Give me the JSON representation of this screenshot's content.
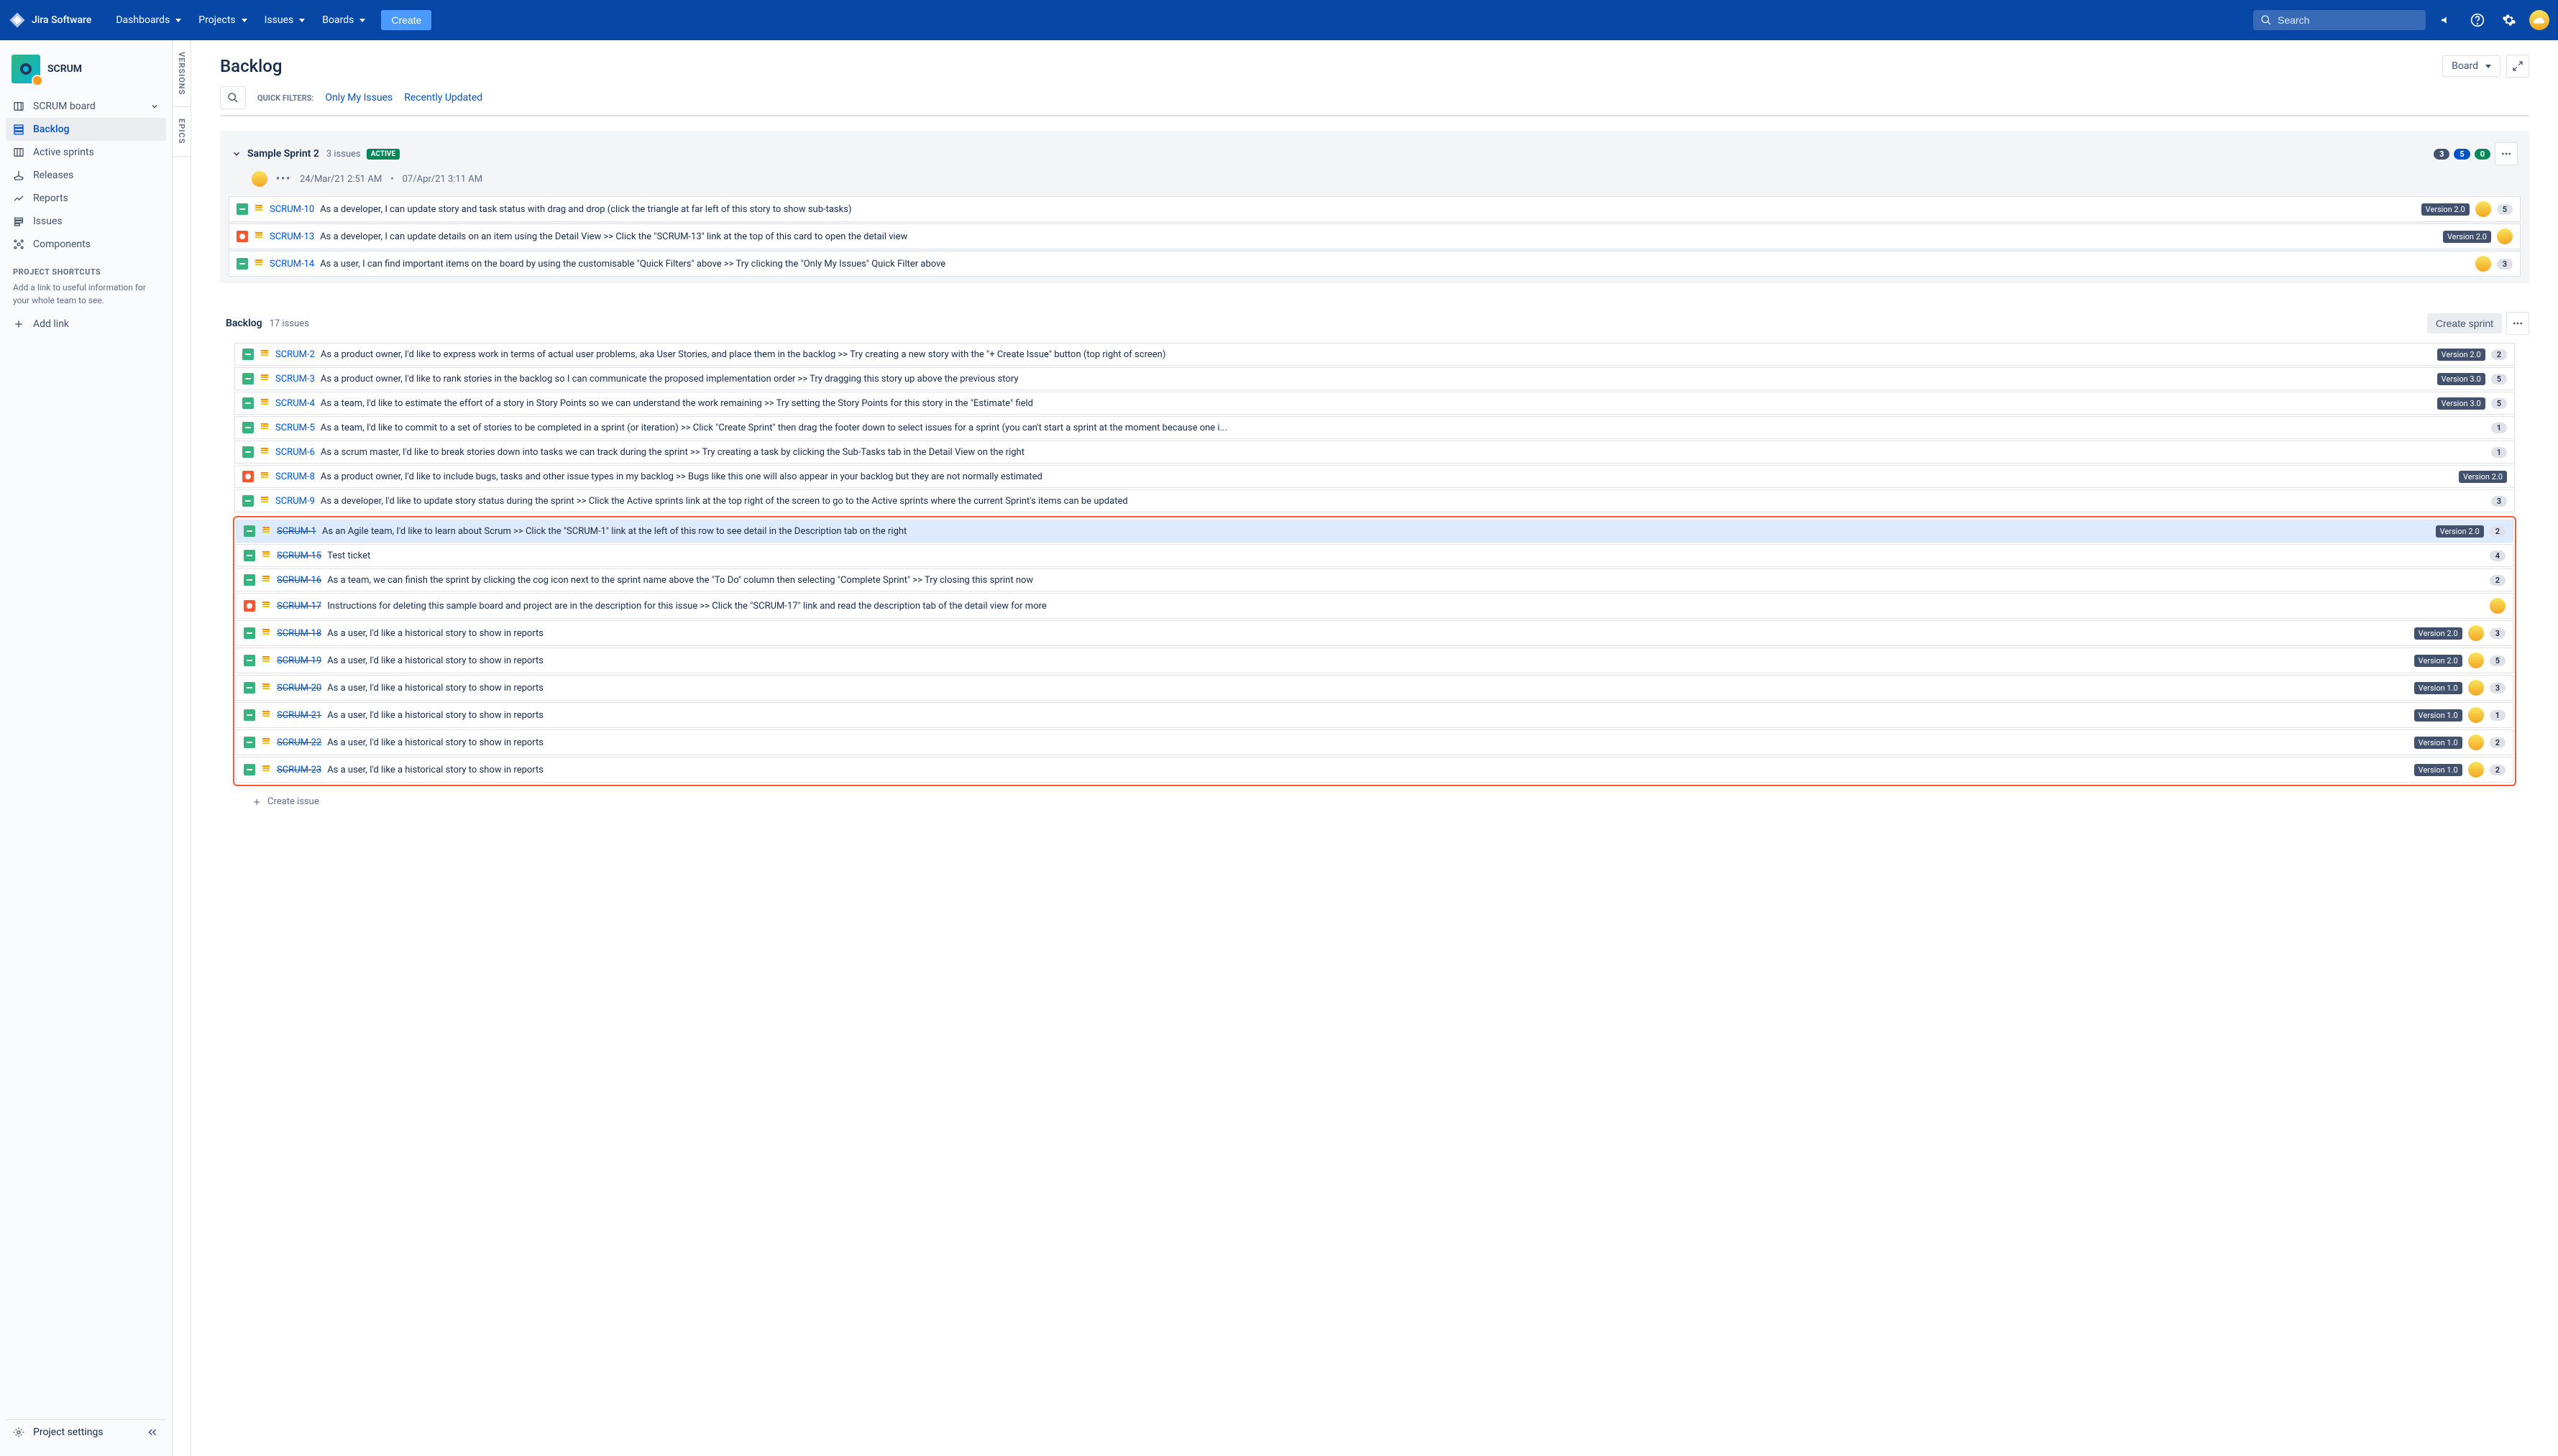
{
  "nav": {
    "product": "Jira Software",
    "items": [
      "Dashboards",
      "Projects",
      "Issues",
      "Boards"
    ],
    "create": "Create",
    "search_placeholder": "Search"
  },
  "project": {
    "name": "SCRUM"
  },
  "sidebar": {
    "board_link": "SCRUM board",
    "items": [
      {
        "label": "Backlog",
        "active": true
      },
      {
        "label": "Active sprints"
      },
      {
        "label": "Releases"
      },
      {
        "label": "Reports"
      },
      {
        "label": "Issues"
      },
      {
        "label": "Components"
      }
    ],
    "shortcuts_title": "PROJECT SHORTCUTS",
    "shortcuts_hint": "Add a link to useful information for your whole team to see.",
    "add_link": "Add link",
    "settings": "Project settings"
  },
  "panels": {
    "versions": "VERSIONS",
    "epics": "EPICS"
  },
  "page": {
    "title": "Backlog",
    "board_btn": "Board",
    "quick_filters": "QUICK FILTERS:",
    "filters": [
      "Only My Issues",
      "Recently Updated"
    ]
  },
  "sprint": {
    "name": "Sample Sprint 2",
    "count": "3 issues",
    "badge": "ACTIVE",
    "pills": [
      "3",
      "5",
      "0"
    ],
    "start": "24/Mar/21 2:51 AM",
    "sep": "•",
    "end": "07/Apr/21 3:11 AM",
    "issues": [
      {
        "type": "story",
        "key": "SCRUM-10",
        "summary": "As a developer, I can update story and task status with drag and drop (click the triangle at far left of this story to show sub-tasks)",
        "version": "Version 2.0",
        "assignee": true,
        "estimate": "5"
      },
      {
        "type": "bug",
        "key": "SCRUM-13",
        "summary": "As a developer, I can update details on an item using the Detail View >> Click the \"SCRUM-13\" link at the top of this card to open the detail view",
        "version": "Version 2.0",
        "assignee": true
      },
      {
        "type": "story",
        "key": "SCRUM-14",
        "summary": "As a user, I can find important items on the board by using the customisable \"Quick Filters\" above >> Try clicking the \"Only My Issues\" Quick Filter above",
        "assignee": true,
        "estimate": "3"
      }
    ]
  },
  "backlog": {
    "name": "Backlog",
    "count": "17 issues",
    "create_sprint": "Create sprint",
    "issues_top": [
      {
        "type": "story",
        "key": "SCRUM-2",
        "summary": "As a product owner, I'd like to express work in terms of actual user problems, aka User Stories, and place them in the backlog >> Try creating a new story with the \"+ Create Issue\" button (top right of screen)",
        "version": "Version 2.0",
        "estimate": "2"
      },
      {
        "type": "story",
        "key": "SCRUM-3",
        "summary": "As a product owner, I'd like to rank stories in the backlog so I can communicate the proposed implementation order >> Try dragging this story up above the previous story",
        "version": "Version 3.0",
        "estimate": "5"
      },
      {
        "type": "story",
        "key": "SCRUM-4",
        "summary": "As a team, I'd like to estimate the effort of a story in Story Points so we can understand the work remaining >> Try setting the Story Points for this story in the \"Estimate\" field",
        "version": "Version 3.0",
        "estimate": "5"
      },
      {
        "type": "story",
        "key": "SCRUM-5",
        "summary": "As a team, I'd like to commit to a set of stories to be completed in a sprint (or iteration) >> Click \"Create Sprint\" then drag the footer down to select issues for a sprint (you can't start a sprint at the moment because one i...",
        "estimate": "1"
      },
      {
        "type": "story",
        "key": "SCRUM-6",
        "summary": "As a scrum master, I'd like to break stories down into tasks we can track during the sprint >> Try creating a task by clicking the Sub-Tasks tab in the Detail View on the right",
        "estimate": "1"
      },
      {
        "type": "bug",
        "key": "SCRUM-8",
        "summary": "As a product owner, I'd like to include bugs, tasks and other issue types in my backlog >> Bugs like this one will also appear in your backlog but they are not normally estimated",
        "version": "Version 2.0"
      },
      {
        "type": "story",
        "key": "SCRUM-9",
        "summary": "As a developer, I'd like to update story status during the sprint >> Click the Active sprints link at the top right of the screen to go to the Active sprints where the current Sprint's items can be updated",
        "estimate": "3"
      }
    ],
    "issues_boxed": [
      {
        "type": "story",
        "key": "SCRUM-1",
        "done": true,
        "selected": true,
        "summary": "As an Agile team, I'd like to learn about Scrum >> Click the \"SCRUM-1\" link at the left of this row to see detail in the Description tab on the right",
        "version": "Version 2.0",
        "estimate": "2"
      },
      {
        "type": "story",
        "key": "SCRUM-15",
        "done": true,
        "summary": "Test ticket",
        "estimate": "4"
      },
      {
        "type": "story",
        "key": "SCRUM-16",
        "done": true,
        "summary": "As a team, we can finish the sprint by clicking the cog icon next to the sprint name above the \"To Do\" column then selecting \"Complete Sprint\" >> Try closing this sprint now",
        "estimate": "2"
      },
      {
        "type": "bug",
        "key": "SCRUM-17",
        "done": true,
        "summary": "Instructions for deleting this sample board and project are in the description for this issue >> Click the \"SCRUM-17\" link and read the description tab of the detail view for more",
        "assignee": true
      },
      {
        "type": "story",
        "key": "SCRUM-18",
        "done": true,
        "summary": "As a user, I'd like a historical story to show in reports",
        "version": "Version 2.0",
        "assignee": true,
        "estimate": "3"
      },
      {
        "type": "story",
        "key": "SCRUM-19",
        "done": true,
        "summary": "As a user, I'd like a historical story to show in reports",
        "version": "Version 2.0",
        "assignee": true,
        "estimate": "5"
      },
      {
        "type": "story",
        "key": "SCRUM-20",
        "done": true,
        "summary": "As a user, I'd like a historical story to show in reports",
        "version": "Version 1.0",
        "assignee": true,
        "estimate": "3"
      },
      {
        "type": "story",
        "key": "SCRUM-21",
        "done": true,
        "summary": "As a user, I'd like a historical story to show in reports",
        "version": "Version 1.0",
        "assignee": true,
        "estimate": "1"
      },
      {
        "type": "story",
        "key": "SCRUM-22",
        "done": true,
        "summary": "As a user, I'd like a historical story to show in reports",
        "version": "Version 1.0",
        "assignee": true,
        "estimate": "2"
      },
      {
        "type": "story",
        "key": "SCRUM-23",
        "done": true,
        "summary": "As a user, I'd like a historical story to show in reports",
        "version": "Version 1.0",
        "assignee": true,
        "estimate": "2"
      }
    ],
    "create_issue": "Create issue"
  }
}
